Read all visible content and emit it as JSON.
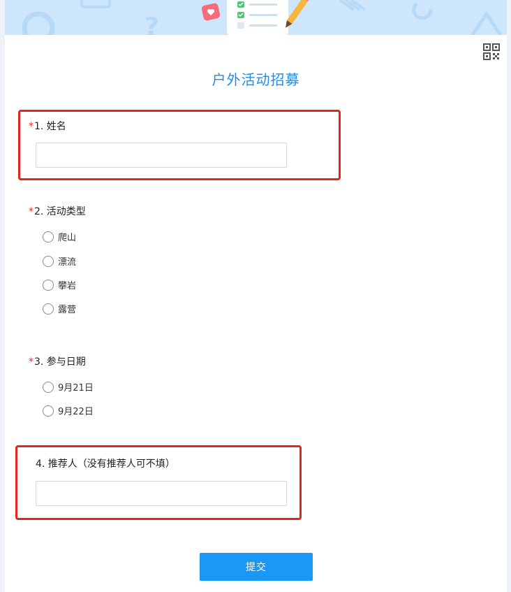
{
  "form": {
    "title": "户外活动招募",
    "required_mark": "*",
    "questions": [
      {
        "label": "1. 姓名",
        "required": true
      },
      {
        "label": "2. 活动类型",
        "required": true,
        "options": [
          "爬山",
          "漂流",
          "攀岩",
          "露营"
        ]
      },
      {
        "label": "3. 参与日期",
        "required": true,
        "options": [
          "9月21日",
          "9月22日"
        ]
      },
      {
        "label": "4. 推荐人（没有推荐人可不填）",
        "required": false
      }
    ],
    "submit_label": "提交"
  },
  "icons": {
    "qr": "qr-code-icon",
    "banner": [
      "question-mark-icon",
      "heart-icon",
      "checklist-icon",
      "pencil-icon",
      "circle-shape-icon"
    ]
  },
  "colors": {
    "title": "#1f8ceb",
    "required": "#e5322d",
    "highlight": "#e0261d",
    "submit": "#1a98f5",
    "banner": "#cde6fb"
  }
}
